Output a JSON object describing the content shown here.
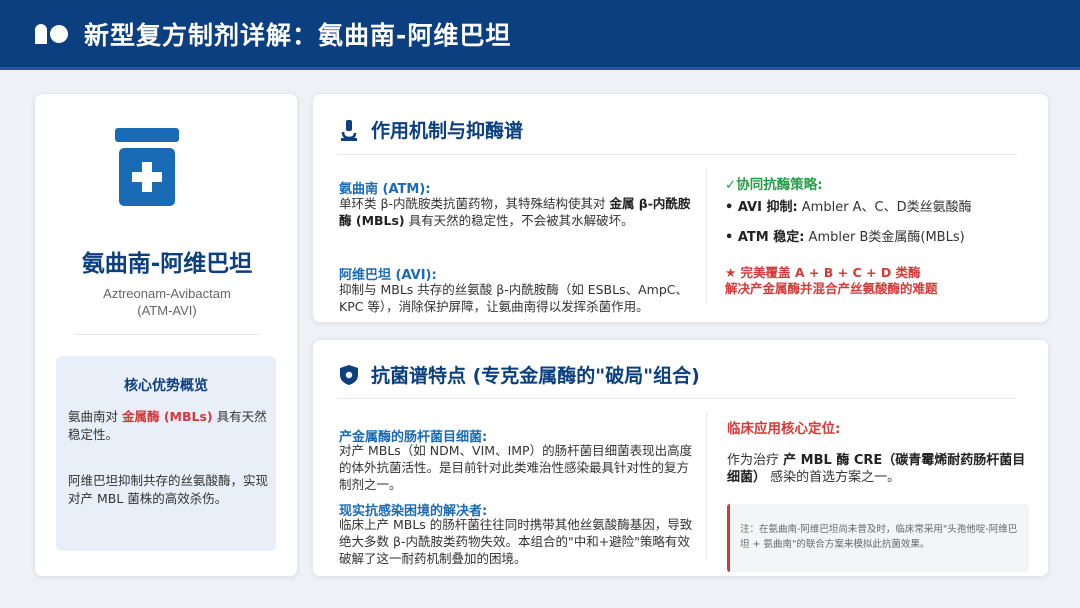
{
  "header": {
    "title": "新型复方制剂详解：氨曲南-阿维巴坦",
    "logo_icon": "pills-icon"
  },
  "colors": {
    "brand": "#0c3f7f",
    "accent": "#1a6bb5",
    "red": "#d43a3a",
    "green": "#2a9d4a"
  },
  "left": {
    "drug_name": "氨曲南-阿维巴坦",
    "drug_en": "Aztreonam-Avibactam",
    "drug_abbr": "(ATM-AVI)",
    "summary": {
      "title": "核心优势概览",
      "p1_pre": "氨曲南对 ",
      "p1_red": "金属酶 (MBLs)",
      "p1_post": " 具有天然稳定性。",
      "p2": "阿维巴坦抑制共存的丝氨酸酶，实现对产 MBL 菌株的高效杀伤。"
    }
  },
  "mechanism": {
    "title": "作用机制与抑酶谱",
    "atm_head": "氨曲南 (ATM):",
    "atm_pre": "单环类 β-内酰胺类抗菌药物，其特殊结构使其对 ",
    "atm_bold": "金属 β-内酰胺酶 (MBLs)",
    "atm_post": " 具有天然的稳定性，不会被其水解破坏。",
    "avi_head": "阿维巴坦 (AVI):",
    "avi_text": "抑制与 MBLs 共存的丝氨酸 β-内酰胺酶（如 ESBLs、AmpC、KPC 等），消除保护屏障，让氨曲南得以发挥杀菌作用。",
    "syn_head": "✓协同抗酶策略:",
    "syn_1_bold": "• AVI 抑制:",
    "syn_1_text": " Ambler A、C、D类丝氨酸酶",
    "syn_2_bold": "• ATM 稳定:",
    "syn_2_text": " Ambler B类金属酶(MBLs)",
    "syn_red_1": "★ 完美覆盖 A + B + C + D 类酶",
    "syn_red_2": "解决产金属酶并混合产丝氨酸酶的难题"
  },
  "spectrum": {
    "title": "抗菌谱特点 (专克金属酶的\"破局\"组合)",
    "h1": "产金属酶的肠杆菌目细菌:",
    "p1": "对产 MBLs（如 NDM、VIM、IMP）的肠杆菌目细菌表现出高度的体外抗菌活性。是目前针对此类难治性感染最具针对性的复方制剂之一。",
    "h2": "现实抗感染困境的解决者:",
    "p2": "临床上产 MBLs 的肠杆菌往往同时携带其他丝氨酸酶基因，导致绝大多数 β-内酰胺类药物失效。本组合的\"中和+避险\"策略有效破解了这一耐药机制叠加的困境。",
    "clin_head": "临床应用核心定位:",
    "clin_pre": "作为治疗 ",
    "clin_bold": "产 MBL 酶 CRE（碳青霉烯耐药肠杆菌目细菌）",
    "clin_post": " 感染的首选方案之一。",
    "note": "注：在氨曲南-阿维巴坦尚未普及时，临床常采用\"头孢他啶-阿维巴坦 + 氨曲南\"的联合方案来模拟此抗菌效果。"
  }
}
